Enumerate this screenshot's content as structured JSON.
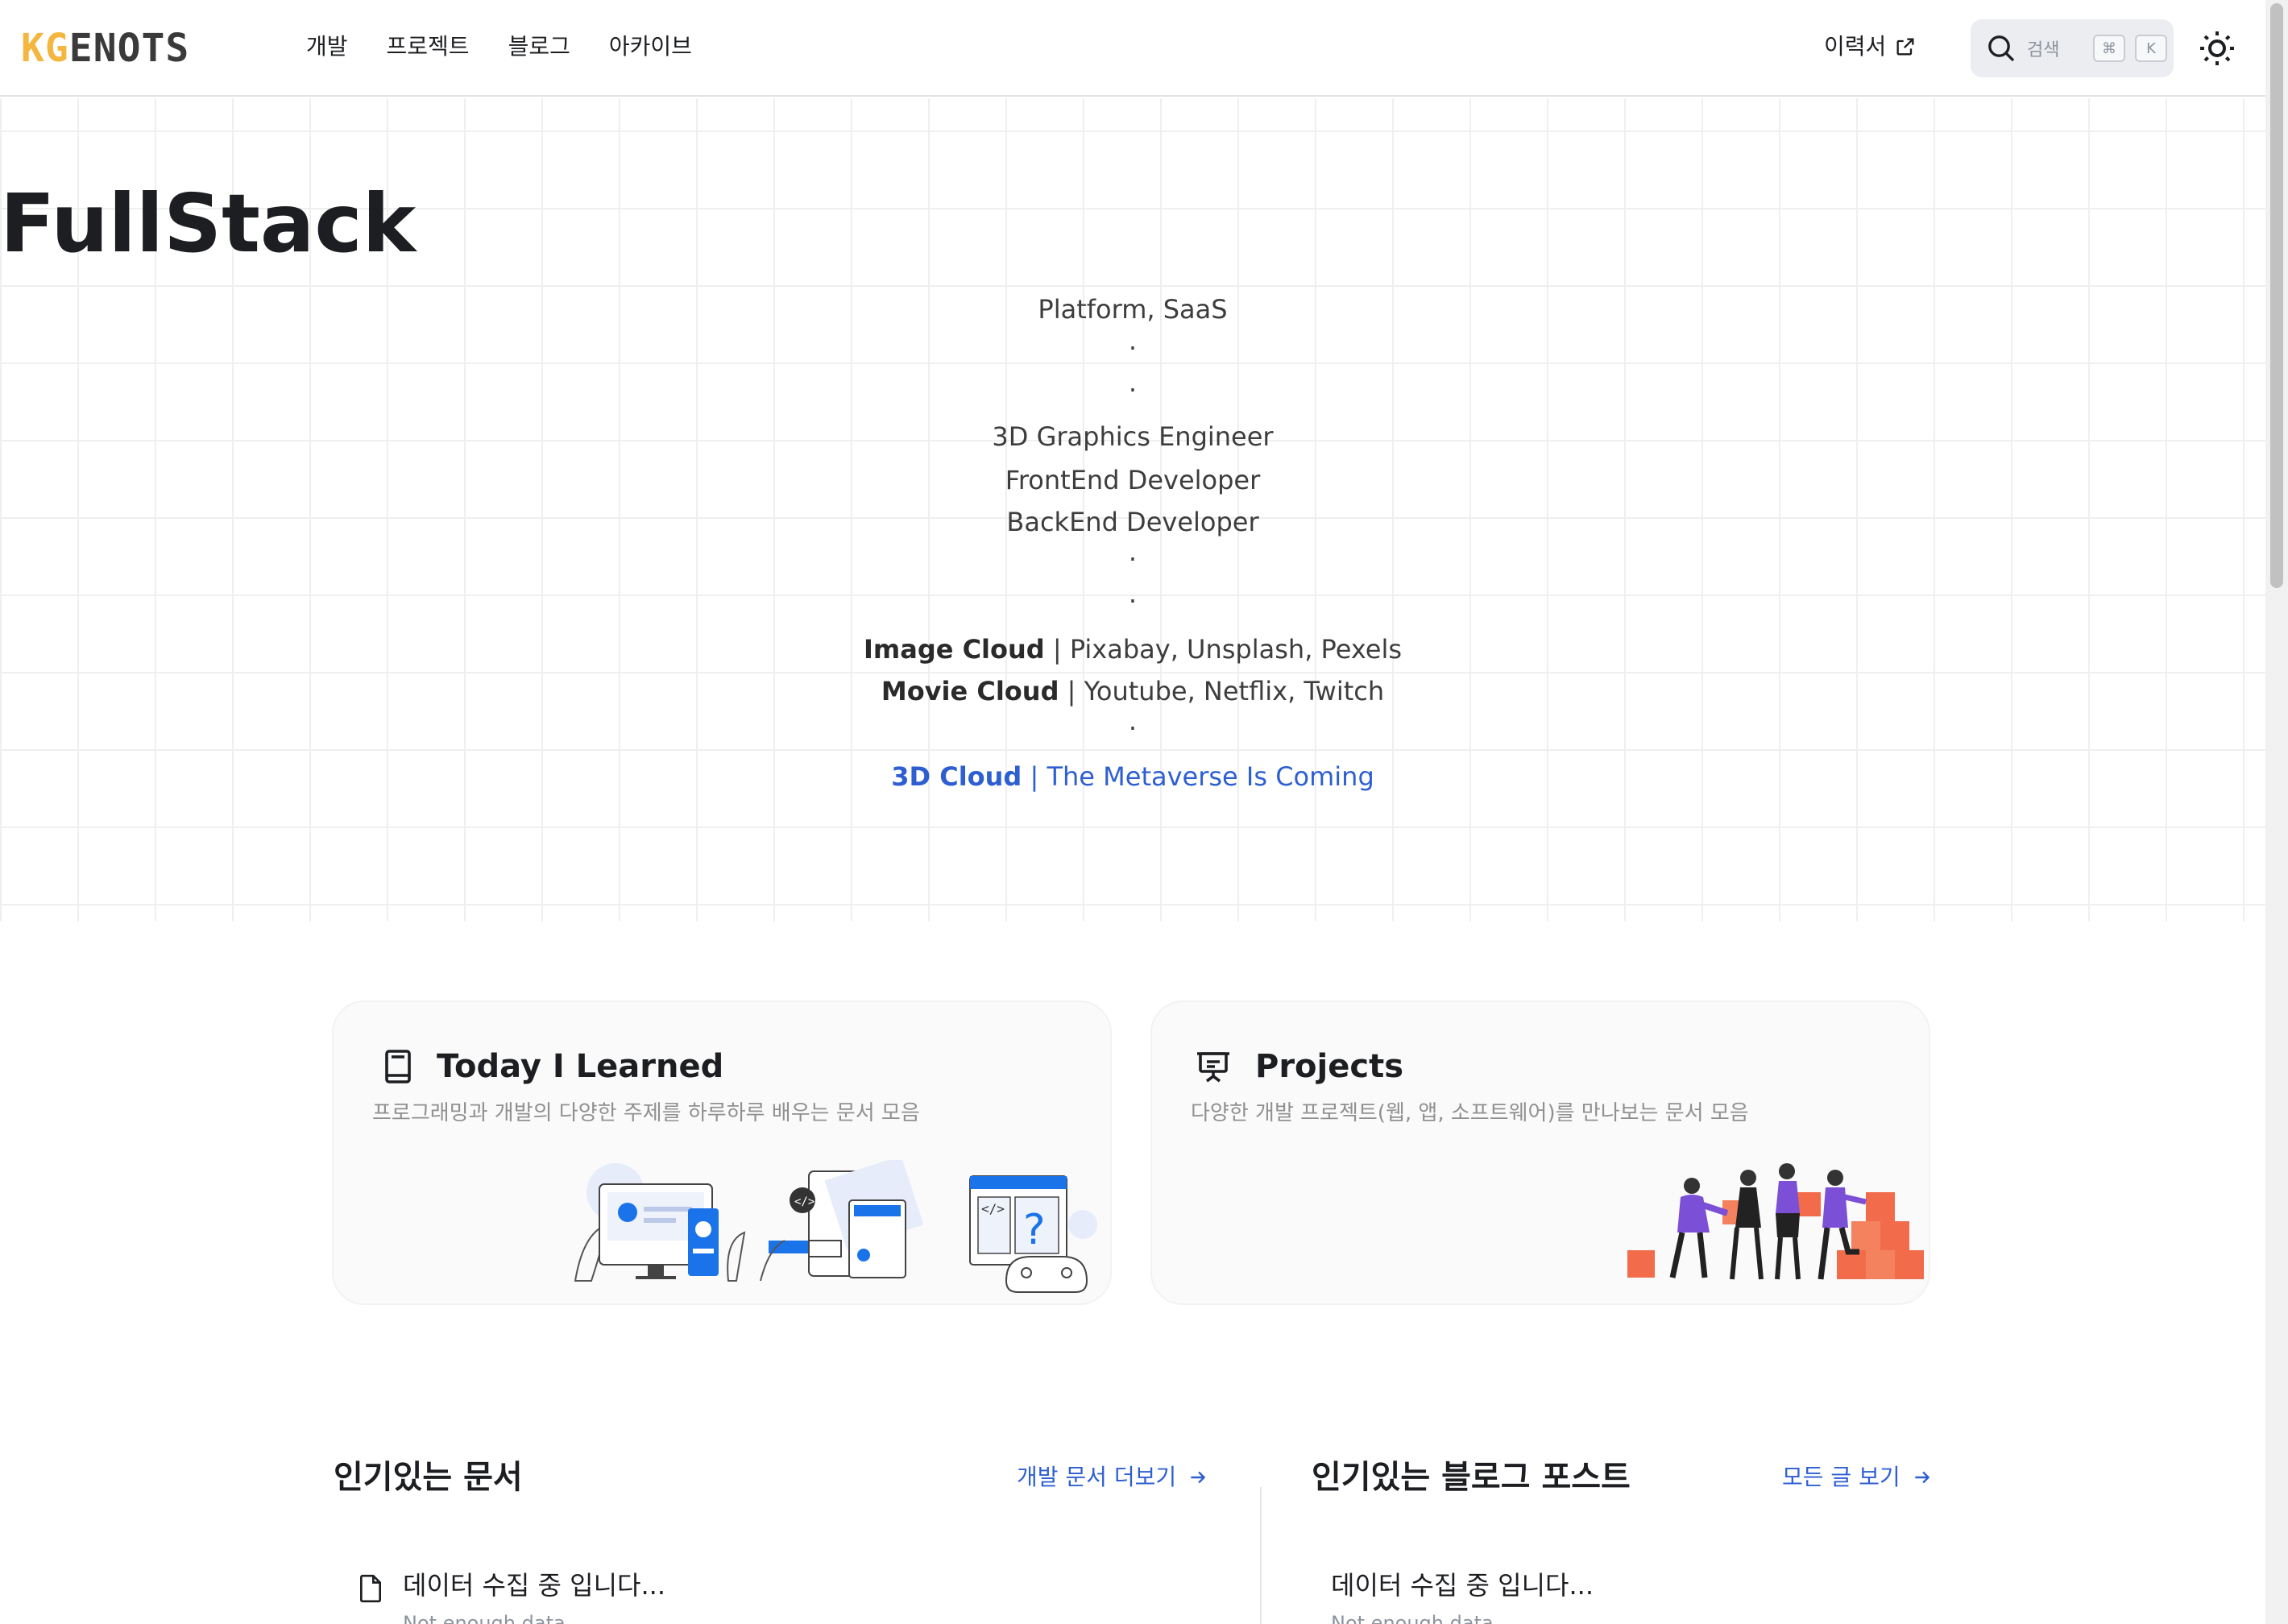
{
  "header": {
    "logo_accent": "KG",
    "logo_rest": "ENOTS",
    "nav": [
      "개발",
      "프로젝트",
      "블로그",
      "아카이브"
    ],
    "resume_label": "이력서",
    "search_placeholder": "검색",
    "search_key1": "⌘",
    "search_key2": "K"
  },
  "hero": {
    "title": "FullStack",
    "lines": {
      "l1": "Platform, SaaS",
      "d1": "·",
      "d2": "·",
      "l2": "3D Graphics Engineer",
      "l3": "FrontEnd Developer",
      "l4": "BackEnd Developer",
      "d3": "·",
      "d4": "·",
      "image_bold": "Image Cloud",
      "image_rest": " | Pixabay, Unsplash, Pexels",
      "movie_bold": "Movie Cloud",
      "movie_rest": " | Youtube, Netflix, Twitch",
      "d5": "·",
      "cloud_bold": "3D Cloud",
      "cloud_rest": " | The Metaverse Is Coming"
    }
  },
  "cards": {
    "til": {
      "title": "Today I Learned",
      "desc": "프로그래밍과 개발의 다양한 주제를 하루하루 배우는 문서 모음"
    },
    "projects": {
      "title": "Projects",
      "desc": "다양한 개발 프로젝트(웹, 앱, 소프트웨어)를 만나보는 문서 모음"
    }
  },
  "popular": {
    "docs_title": "인기있는 문서",
    "docs_more": "개발 문서 더보기",
    "blog_title": "인기있는 블로그 포스트",
    "blog_more": "모든 글 보기",
    "docs_item_title": "데이터 수집 중 입니다...",
    "docs_item_sub": "Not enough data",
    "blog_item_title": "데이터 수집 중 입니다...",
    "blog_item_sub": "Not enough data"
  },
  "colors": {
    "accent": "#2e5fd1",
    "logo_accent": "#f4b63f",
    "illustration_purple": "#7b4fd6",
    "illustration_orange": "#f26b4a",
    "illustration_blue": "#1a73e8"
  }
}
